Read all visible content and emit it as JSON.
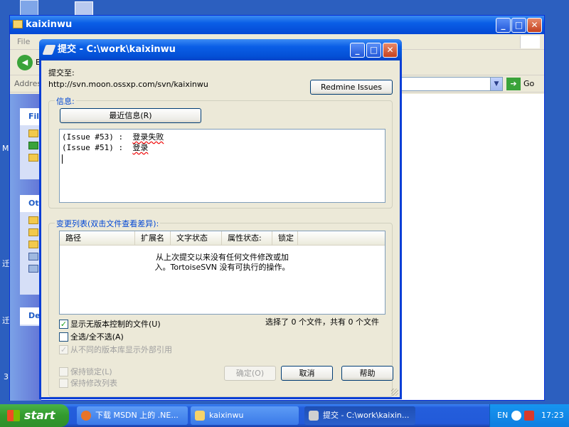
{
  "explorer": {
    "title": "kaixinwu",
    "menu_file": "File",
    "back_label": "B",
    "address_label": "Addres",
    "go_label": "Go",
    "panel_file": "File",
    "panel_other": "Oth",
    "panel_details": "De"
  },
  "desktop": {
    "char1": "M",
    "char2": "迁",
    "char3": "迁",
    "char4": "3"
  },
  "dialog": {
    "title": "提交 - C:\\work\\kaixinwu",
    "commit_to_label": "提交至:",
    "url": "http://svn.moon.ossxp.com/svn/kaixinwu",
    "redmine_button": "Redmine Issues",
    "message_group": "信息:",
    "recent_button": "最近信息(R)",
    "message_lines": [
      {
        "prefix": "(Issue #53) :  ",
        "text": "登录失败"
      },
      {
        "prefix": "(Issue #51) :  ",
        "text": "登录"
      }
    ],
    "changes_group": "变更列表(双击文件查看差异):",
    "columns": [
      "路径",
      "扩展名",
      "文字状态",
      "属性状态:",
      "锁定"
    ],
    "empty_line1": "从上次提交以来没有任何文件修改或加",
    "empty_line2": "入。TortoiseSVN 没有可执行的操作。",
    "show_unversioned": "显示无版本控制的文件(U)",
    "select_all": "全选/全不选(A)",
    "show_externals": "从不同的版本库显示外部引用",
    "selection_status": "选择了 0 个文件，共有 0 个文件",
    "keep_locks": "保持锁定(L)",
    "keep_changelists": "保持修改列表",
    "ok_button": "确定(O)",
    "cancel_button": "取消",
    "help_button": "帮助"
  },
  "taskbar": {
    "start": "start",
    "items": [
      "下载 MSDN 上的 .NE...",
      "kaixinwu",
      "提交 - C:\\work\\kaixin..."
    ],
    "lang": "EN",
    "clock": "17:23"
  }
}
